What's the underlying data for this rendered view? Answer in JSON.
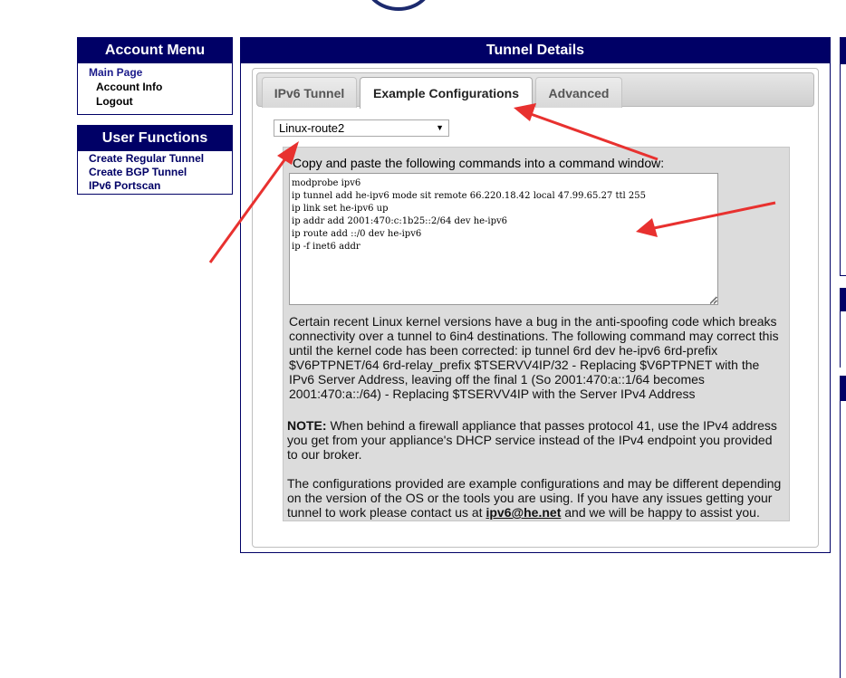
{
  "account_menu": {
    "title": "Account Menu",
    "items": [
      "Main Page",
      "Account Info",
      "Logout"
    ]
  },
  "user_functions": {
    "title": "User Functions",
    "items": [
      "Create Regular Tunnel",
      "Create BGP Tunnel",
      "IPv6 Portscan"
    ]
  },
  "main": {
    "title": "Tunnel Details",
    "tabs": [
      "IPv6 Tunnel",
      "Example Configurations",
      "Advanced"
    ],
    "active_tab": "Example Configurations",
    "os_select": "Linux-route2",
    "instructions": "Copy and paste the following commands into a command window:",
    "commands": "modprobe ipv6\nip tunnel add he-ipv6 mode sit remote 66.220.18.42 local 47.99.65.27 ttl 255\nip link set he-ipv6 up\nip addr add 2001:470:c:1b25::2/64 dev he-ipv6\nip route add ::/0 dev he-ipv6\nip -f inet6 addr",
    "note_bug": "Certain recent Linux kernel versions have a bug in the anti-spoofing code which breaks connectivity over a tunnel to 6in4 destinations. The following command may correct this until the kernel code has been corrected: ip tunnel 6rd dev he-ipv6 6rd-prefix $V6PTPNET/64 6rd-relay_prefix $TSERVV4IP/32 - Replacing $V6PTPNET with the IPv6 Server Address, leaving off the final 1 (So 2001:470:a::1/64 becomes 2001:470:a::/64) - Replacing $TSERVV4IP with the Server IPv4 Address",
    "note_label": "NOTE:",
    "note_firewall": " When behind a firewall appliance that passes protocol 41, use the IPv4 address you get from your appliance's DHCP service instead of the IPv4 endpoint you provided to our broker.",
    "disclaimer_pre": "The configurations provided are example configurations and may be different depending on the version of the OS or the tools you are using. If you have any issues getting your tunnel to work please contact us at ",
    "contact_email": "ipv6@he.net",
    "disclaimer_post": " and we will be happy to assist you."
  },
  "colors": {
    "header_navy": "#000066",
    "annotation_red": "#e8312f",
    "panel_gray": "#dcdcdc"
  }
}
